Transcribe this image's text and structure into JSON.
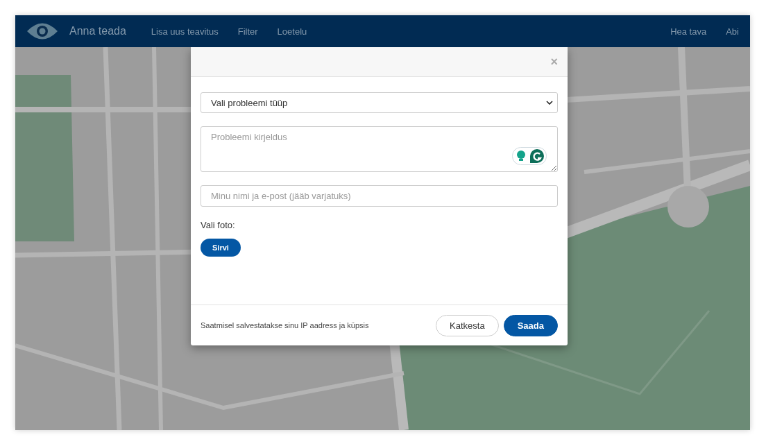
{
  "navbar": {
    "brand": "Anna teada",
    "links": [
      "Lisa uus teavitus",
      "Filter",
      "Loetelu"
    ],
    "right_links": [
      "Hea tava",
      "Abi"
    ]
  },
  "dialog": {
    "close": "×",
    "type_select": {
      "value": "Vali probleemi tüüp"
    },
    "description": {
      "placeholder": "Probleemi kirjeldus"
    },
    "contact": {
      "placeholder": "Minu nimi ja e-post (jääb varjatuks)"
    },
    "photo_label": "Vali foto:",
    "browse_button": "Sirvi",
    "footer_note": "Saatmisel salvestatakse sinu IP aadress ja küpsis",
    "buttons": [
      {
        "label": "Katkesta",
        "kind": "secondary"
      },
      {
        "label": "Saada",
        "kind": "primary"
      }
    ]
  }
}
